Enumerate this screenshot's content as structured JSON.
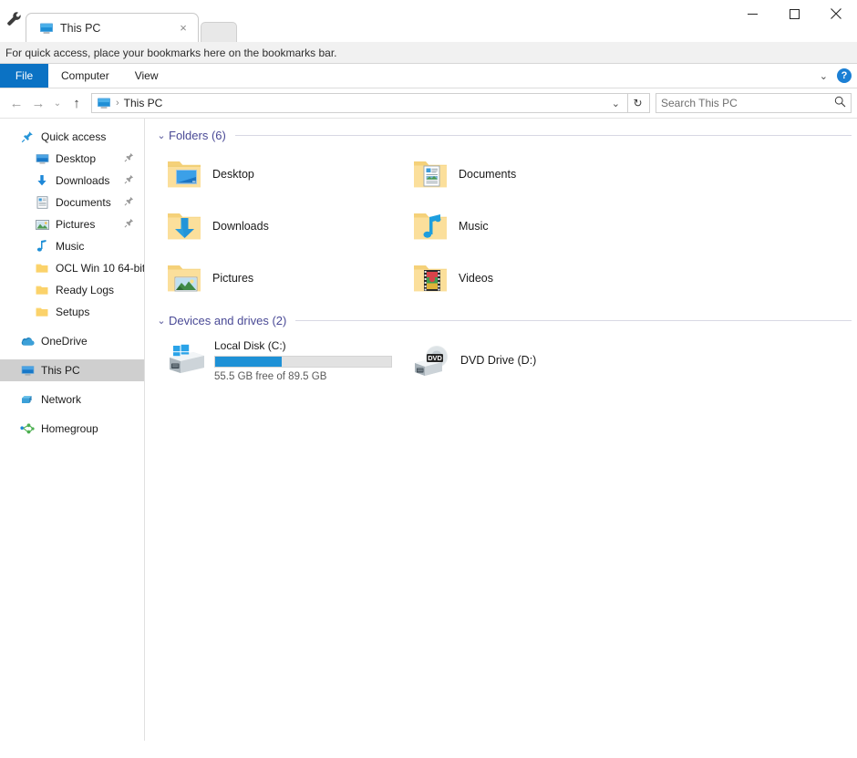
{
  "browser": {
    "wrench_icon": "wrench-icon",
    "tab": {
      "title": "This PC",
      "icon": "monitor-icon",
      "close_label": "×"
    },
    "new_tab_label": "",
    "window_controls": {
      "minimize": "─",
      "maximize": "□",
      "close": "✕"
    },
    "bookmarks_bar_text": "For quick access, place your bookmarks here on the bookmarks bar."
  },
  "ribbon": {
    "file_label": "File",
    "tabs": [
      "Computer",
      "View"
    ],
    "collapse_icon": "chevron-down-icon",
    "help_label": "?"
  },
  "addressbar": {
    "back_icon": "←",
    "forward_icon": "→",
    "recent_icon": "⌄",
    "up_icon": "↑",
    "crumb_icon": "monitor-icon",
    "crumb_separator": "›",
    "crumb_text": "This PC",
    "dropdown_icon": "⌄",
    "refresh_icon": "↻",
    "search_placeholder": "Search This PC",
    "search_value": "",
    "search_icon": "search-icon"
  },
  "sidebar": {
    "items": [
      {
        "label": "Quick access",
        "icon": "pin-star-icon",
        "level": 0,
        "pinned": false,
        "selected": false
      },
      {
        "label": "Desktop",
        "icon": "desktop-icon",
        "level": 1,
        "pinned": true,
        "selected": false
      },
      {
        "label": "Downloads",
        "icon": "download-icon",
        "level": 1,
        "pinned": true,
        "selected": false
      },
      {
        "label": "Documents",
        "icon": "document-icon",
        "level": 1,
        "pinned": true,
        "selected": false
      },
      {
        "label": "Pictures",
        "icon": "pictures-icon",
        "level": 1,
        "pinned": true,
        "selected": false
      },
      {
        "label": "Music",
        "icon": "music-note-icon",
        "level": 1,
        "pinned": false,
        "selected": false
      },
      {
        "label": "OCL Win 10 64-bit",
        "icon": "folder-icon",
        "level": 1,
        "pinned": false,
        "selected": false
      },
      {
        "label": "Ready Logs",
        "icon": "folder-icon",
        "level": 1,
        "pinned": false,
        "selected": false
      },
      {
        "label": "Setups",
        "icon": "folder-icon",
        "level": 1,
        "pinned": false,
        "selected": false
      },
      {
        "label": "OneDrive",
        "icon": "onedrive-cloud-icon",
        "level": 0,
        "pinned": false,
        "selected": false
      },
      {
        "label": "This PC",
        "icon": "monitor-icon",
        "level": 0,
        "pinned": false,
        "selected": true
      },
      {
        "label": "Network",
        "icon": "network-icon",
        "level": 0,
        "pinned": false,
        "selected": false
      },
      {
        "label": "Homegroup",
        "icon": "homegroup-icon",
        "level": 0,
        "pinned": false,
        "selected": false
      }
    ]
  },
  "main": {
    "groups": [
      {
        "title": "Folders (6)",
        "expanded": true,
        "items": [
          {
            "label": "Desktop",
            "icon": "folder-desktop-icon"
          },
          {
            "label": "Documents",
            "icon": "folder-documents-icon"
          },
          {
            "label": "Downloads",
            "icon": "folder-downloads-icon"
          },
          {
            "label": "Music",
            "icon": "folder-music-icon"
          },
          {
            "label": "Pictures",
            "icon": "folder-pictures-icon"
          },
          {
            "label": "Videos",
            "icon": "folder-videos-icon"
          }
        ]
      },
      {
        "title": "Devices and drives (2)",
        "expanded": true,
        "drives": [
          {
            "name": "Local Disk (C:)",
            "icon": "windows-drive-icon",
            "free_text": "55.5 GB free of 89.5 GB",
            "used_percent": 38,
            "bar_color": "#1e91d6",
            "has_bar": true
          },
          {
            "name": "DVD Drive (D:)",
            "icon": "dvd-drive-icon",
            "has_bar": false
          }
        ]
      }
    ]
  },
  "colors": {
    "accent": "#0b72c4",
    "group_header": "#4a4a96",
    "drive_bar": "#1e91d6",
    "selection": "#cfcfcf"
  }
}
